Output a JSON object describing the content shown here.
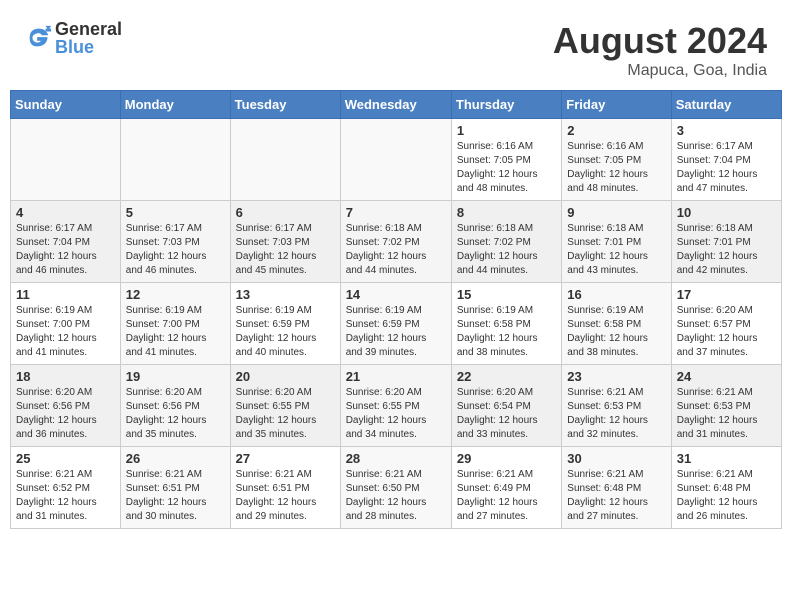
{
  "header": {
    "logo_general": "General",
    "logo_blue": "Blue",
    "month_year": "August 2024",
    "location": "Mapuca, Goa, India"
  },
  "calendar": {
    "days_of_week": [
      "Sunday",
      "Monday",
      "Tuesday",
      "Wednesday",
      "Thursday",
      "Friday",
      "Saturday"
    ],
    "weeks": [
      [
        {
          "day": "",
          "info": ""
        },
        {
          "day": "",
          "info": ""
        },
        {
          "day": "",
          "info": ""
        },
        {
          "day": "",
          "info": ""
        },
        {
          "day": "1",
          "info": "Sunrise: 6:16 AM\nSunset: 7:05 PM\nDaylight: 12 hours\nand 48 minutes."
        },
        {
          "day": "2",
          "info": "Sunrise: 6:16 AM\nSunset: 7:05 PM\nDaylight: 12 hours\nand 48 minutes."
        },
        {
          "day": "3",
          "info": "Sunrise: 6:17 AM\nSunset: 7:04 PM\nDaylight: 12 hours\nand 47 minutes."
        }
      ],
      [
        {
          "day": "4",
          "info": "Sunrise: 6:17 AM\nSunset: 7:04 PM\nDaylight: 12 hours\nand 46 minutes."
        },
        {
          "day": "5",
          "info": "Sunrise: 6:17 AM\nSunset: 7:03 PM\nDaylight: 12 hours\nand 46 minutes."
        },
        {
          "day": "6",
          "info": "Sunrise: 6:17 AM\nSunset: 7:03 PM\nDaylight: 12 hours\nand 45 minutes."
        },
        {
          "day": "7",
          "info": "Sunrise: 6:18 AM\nSunset: 7:02 PM\nDaylight: 12 hours\nand 44 minutes."
        },
        {
          "day": "8",
          "info": "Sunrise: 6:18 AM\nSunset: 7:02 PM\nDaylight: 12 hours\nand 44 minutes."
        },
        {
          "day": "9",
          "info": "Sunrise: 6:18 AM\nSunset: 7:01 PM\nDaylight: 12 hours\nand 43 minutes."
        },
        {
          "day": "10",
          "info": "Sunrise: 6:18 AM\nSunset: 7:01 PM\nDaylight: 12 hours\nand 42 minutes."
        }
      ],
      [
        {
          "day": "11",
          "info": "Sunrise: 6:19 AM\nSunset: 7:00 PM\nDaylight: 12 hours\nand 41 minutes."
        },
        {
          "day": "12",
          "info": "Sunrise: 6:19 AM\nSunset: 7:00 PM\nDaylight: 12 hours\nand 41 minutes."
        },
        {
          "day": "13",
          "info": "Sunrise: 6:19 AM\nSunset: 6:59 PM\nDaylight: 12 hours\nand 40 minutes."
        },
        {
          "day": "14",
          "info": "Sunrise: 6:19 AM\nSunset: 6:59 PM\nDaylight: 12 hours\nand 39 minutes."
        },
        {
          "day": "15",
          "info": "Sunrise: 6:19 AM\nSunset: 6:58 PM\nDaylight: 12 hours\nand 38 minutes."
        },
        {
          "day": "16",
          "info": "Sunrise: 6:19 AM\nSunset: 6:58 PM\nDaylight: 12 hours\nand 38 minutes."
        },
        {
          "day": "17",
          "info": "Sunrise: 6:20 AM\nSunset: 6:57 PM\nDaylight: 12 hours\nand 37 minutes."
        }
      ],
      [
        {
          "day": "18",
          "info": "Sunrise: 6:20 AM\nSunset: 6:56 PM\nDaylight: 12 hours\nand 36 minutes."
        },
        {
          "day": "19",
          "info": "Sunrise: 6:20 AM\nSunset: 6:56 PM\nDaylight: 12 hours\nand 35 minutes."
        },
        {
          "day": "20",
          "info": "Sunrise: 6:20 AM\nSunset: 6:55 PM\nDaylight: 12 hours\nand 35 minutes."
        },
        {
          "day": "21",
          "info": "Sunrise: 6:20 AM\nSunset: 6:55 PM\nDaylight: 12 hours\nand 34 minutes."
        },
        {
          "day": "22",
          "info": "Sunrise: 6:20 AM\nSunset: 6:54 PM\nDaylight: 12 hours\nand 33 minutes."
        },
        {
          "day": "23",
          "info": "Sunrise: 6:21 AM\nSunset: 6:53 PM\nDaylight: 12 hours\nand 32 minutes."
        },
        {
          "day": "24",
          "info": "Sunrise: 6:21 AM\nSunset: 6:53 PM\nDaylight: 12 hours\nand 31 minutes."
        }
      ],
      [
        {
          "day": "25",
          "info": "Sunrise: 6:21 AM\nSunset: 6:52 PM\nDaylight: 12 hours\nand 31 minutes."
        },
        {
          "day": "26",
          "info": "Sunrise: 6:21 AM\nSunset: 6:51 PM\nDaylight: 12 hours\nand 30 minutes."
        },
        {
          "day": "27",
          "info": "Sunrise: 6:21 AM\nSunset: 6:51 PM\nDaylight: 12 hours\nand 29 minutes."
        },
        {
          "day": "28",
          "info": "Sunrise: 6:21 AM\nSunset: 6:50 PM\nDaylight: 12 hours\nand 28 minutes."
        },
        {
          "day": "29",
          "info": "Sunrise: 6:21 AM\nSunset: 6:49 PM\nDaylight: 12 hours\nand 27 minutes."
        },
        {
          "day": "30",
          "info": "Sunrise: 6:21 AM\nSunset: 6:48 PM\nDaylight: 12 hours\nand 27 minutes."
        },
        {
          "day": "31",
          "info": "Sunrise: 6:21 AM\nSunset: 6:48 PM\nDaylight: 12 hours\nand 26 minutes."
        }
      ]
    ]
  }
}
